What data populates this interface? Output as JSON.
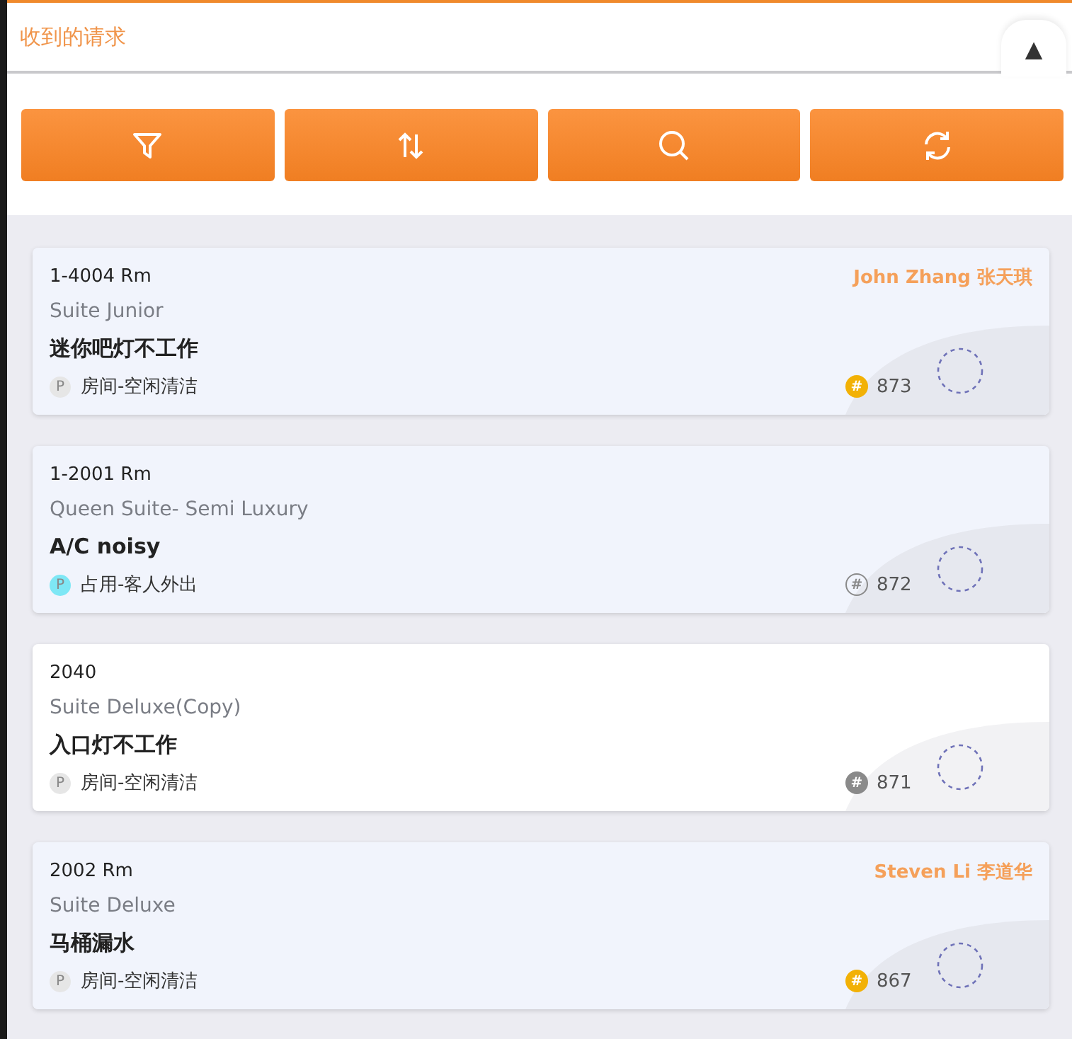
{
  "header": {
    "title": "收到的请求",
    "collapse_icon": "▲"
  },
  "toolbar": {
    "buttons": [
      {
        "kind": "filter"
      },
      {
        "kind": "sort"
      },
      {
        "kind": "search"
      },
      {
        "kind": "refresh"
      }
    ]
  },
  "requests": [
    {
      "room": "1-4004 Rm",
      "room_type": "Suite Junior",
      "title": "迷你吧灯不工作",
      "assignee": "John Zhang 张天琪",
      "status_badge": {
        "label": "P",
        "color": "#e6e6e6"
      },
      "status": "房间-空闲清洁",
      "number_badge": {
        "label": "#",
        "kind": "filled",
        "color": "#f2b106"
      },
      "number": "873",
      "highlighted": true
    },
    {
      "room": "1-2001 Rm",
      "room_type": "Queen Suite- Semi Luxury",
      "title": "A/C noisy",
      "status_badge": {
        "label": "P",
        "color": "#7ee7f5"
      },
      "status": "占用-客人外出",
      "number_badge": {
        "label": "#",
        "kind": "outline",
        "color": "#8a8a8a"
      },
      "number": "872",
      "highlighted": true
    },
    {
      "room": "2040",
      "room_type": "Suite Deluxe(Copy)",
      "title": "入口灯不工作",
      "status_badge": {
        "label": "P",
        "color": "#e6e6e6"
      },
      "status": "房间-空闲清洁",
      "number_badge": {
        "label": "#",
        "kind": "filled",
        "color": "#8a8a8a"
      },
      "number": "871",
      "highlighted": false
    },
    {
      "room": "2002 Rm",
      "room_type": "Suite Deluxe",
      "title": "马桶漏水",
      "assignee": "Steven Li 李道华",
      "status_badge": {
        "label": "P",
        "color": "#e6e6e6"
      },
      "status": "房间-空闲清洁",
      "number_badge": {
        "label": "#",
        "kind": "filled",
        "color": "#f2b106"
      },
      "number": "867",
      "highlighted": true
    }
  ]
}
